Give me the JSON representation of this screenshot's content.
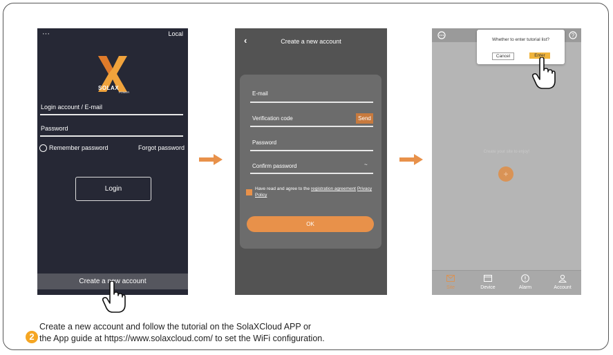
{
  "screen1": {
    "menu_dots": "···",
    "local_label": "Local",
    "logo_text": "SOLAX",
    "logo_sub": "POWER",
    "login_account_placeholder": "Login account / E-mail",
    "password_placeholder": "Password",
    "remember_password": "Remember password",
    "forgot_password": "Forgot password",
    "login_button": "Login",
    "create_account_button": "Create a new account"
  },
  "screen2": {
    "back_icon": "‹",
    "title": "Create a new account",
    "email_placeholder": "E-mail",
    "verification_placeholder": "Verification code",
    "send_button": "Send",
    "password_placeholder": "Password",
    "confirm_password_placeholder": "Confirm password",
    "agree_text": "Have read and agree to the",
    "registration_link": "registration agreement",
    "privacy_link": "Privacy Policy",
    "ok_button": "OK"
  },
  "screen3": {
    "dialog_title": "Whether to enter tutorial list?",
    "cancel_button": "Cancel",
    "enter_button": "Enter",
    "empty_text": "Create your site to enjoy!",
    "add_icon": "+",
    "nav": [
      {
        "label": "Site",
        "icon": "mail-icon"
      },
      {
        "label": "Device",
        "icon": "device-icon"
      },
      {
        "label": "Alarm",
        "icon": "alarm-icon"
      },
      {
        "label": "Account",
        "icon": "account-icon"
      }
    ]
  },
  "caption": {
    "step_number": "2",
    "line1": "Create a new account and follow the tutorial on the SolaXCloud APP or",
    "line2": "the App guide at https://www.solaxcloud.com/ to set the WiFi configuration."
  },
  "colors": {
    "accent": "#e8914a",
    "step": "#f5a623",
    "screen1_bg": "#262835",
    "screen2_bg": "#535353",
    "screen3_bg": "#b5b5b5"
  }
}
